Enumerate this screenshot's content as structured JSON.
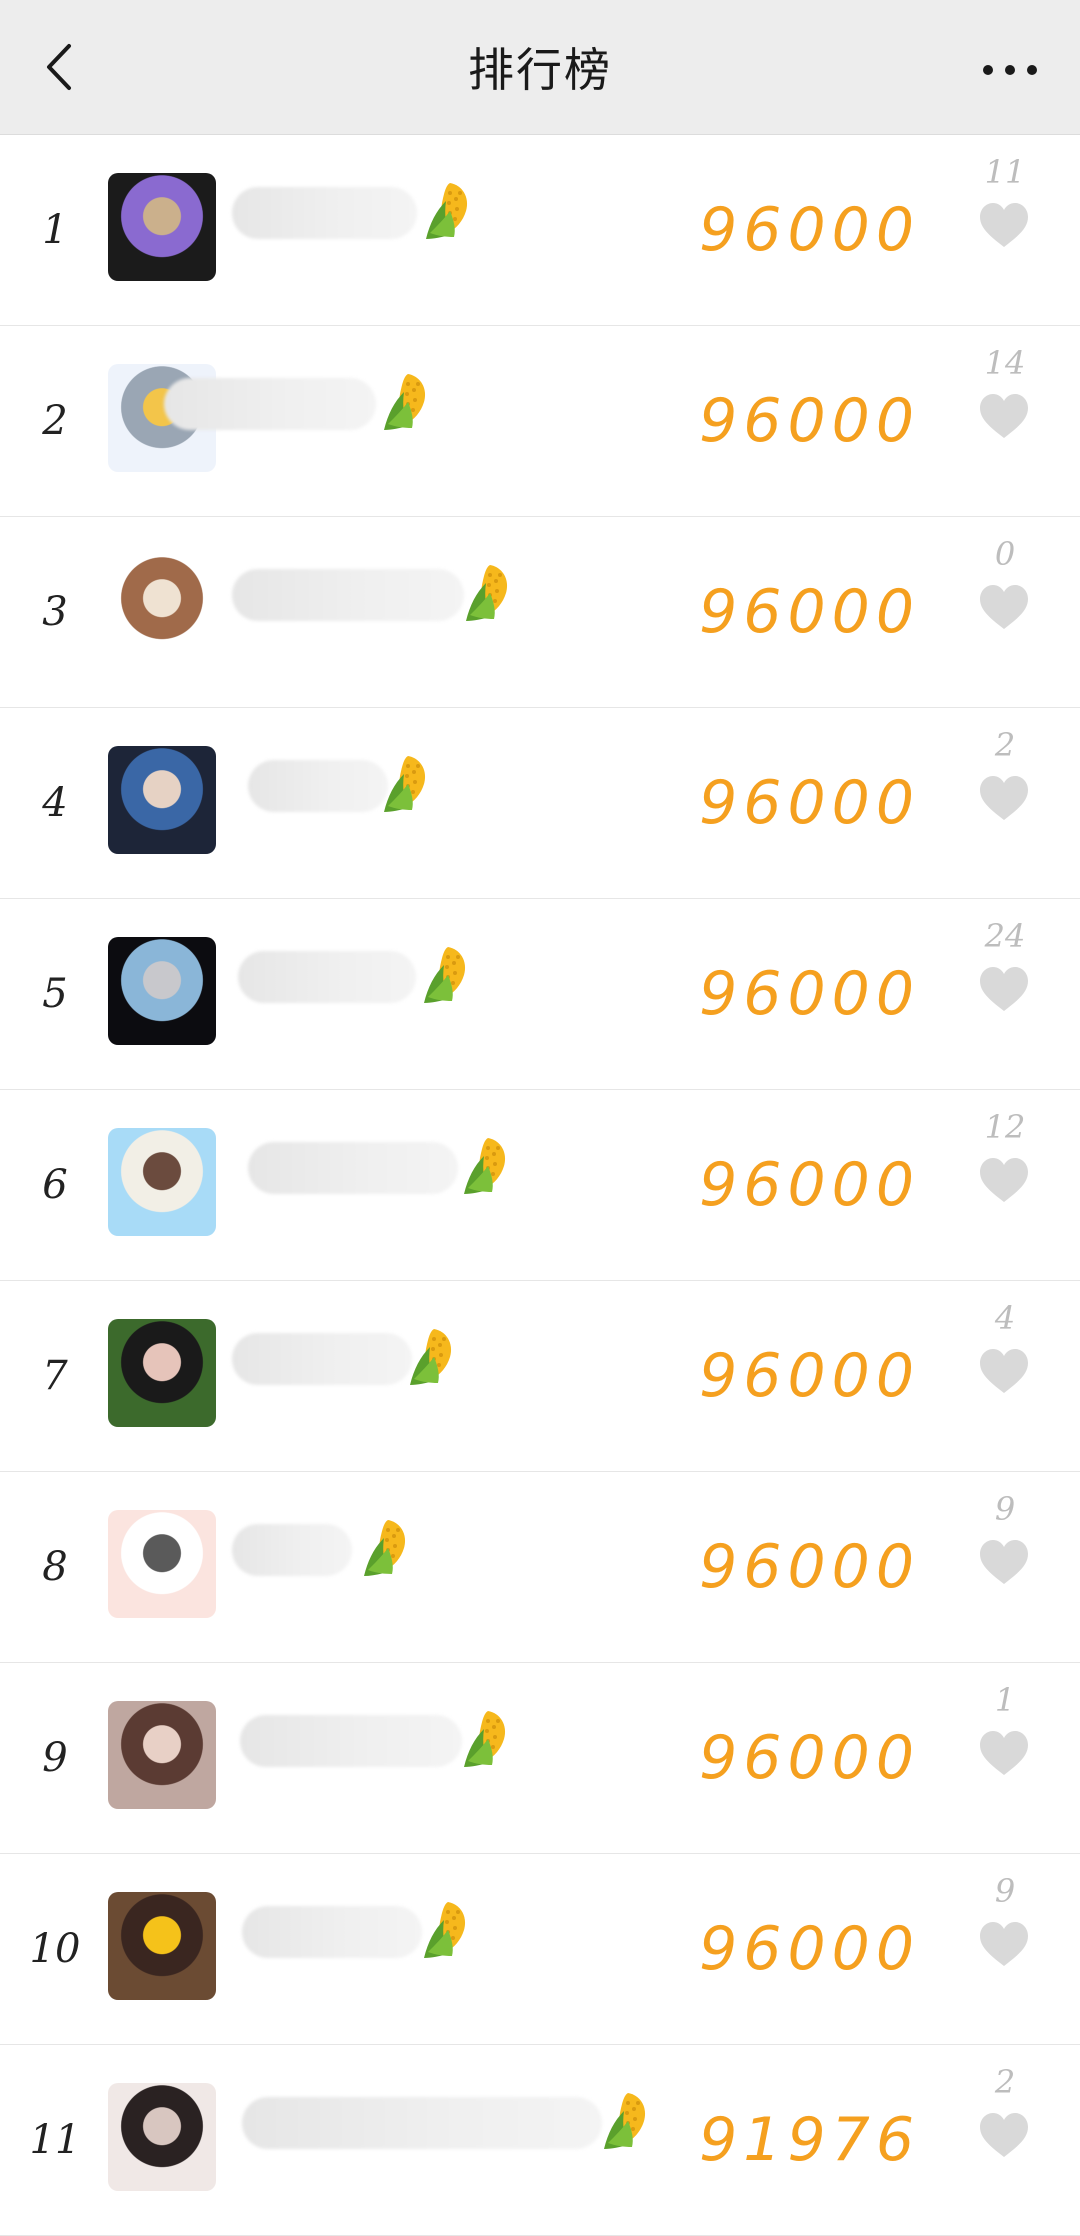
{
  "header": {
    "title": "排行榜",
    "back_icon": "chevron-left-icon",
    "more_icon": "more-horizontal-icon"
  },
  "colors": {
    "header_bg": "#ededed",
    "score": "#f5a01f",
    "likes": "#bdbdbd",
    "heart": "#d9d9d9"
  },
  "rows": [
    {
      "rank": "1",
      "score": "96000",
      "likes": "11",
      "avatar_colors": [
        "#1b1b1b",
        "#8a6ad0",
        "#cbb08c"
      ]
    },
    {
      "rank": "2",
      "score": "96000",
      "likes": "14",
      "avatar_colors": [
        "#eef3fb",
        "#9aa6b4",
        "#f3c54a"
      ]
    },
    {
      "rank": "3",
      "score": "96000",
      "likes": "0",
      "avatar_colors": [
        "#ffffff",
        "#a06a4a",
        "#efe2d2"
      ]
    },
    {
      "rank": "4",
      "score": "96000",
      "likes": "2",
      "avatar_colors": [
        "#1d2538",
        "#3a67a6",
        "#e6d2c4"
      ]
    },
    {
      "rank": "5",
      "score": "96000",
      "likes": "24",
      "avatar_colors": [
        "#0c0c10",
        "#8ab6d8",
        "#c8c8cc"
      ]
    },
    {
      "rank": "6",
      "score": "96000",
      "likes": "12",
      "avatar_colors": [
        "#a8dbf7",
        "#f2efe6",
        "#6b4b3e"
      ]
    },
    {
      "rank": "7",
      "score": "96000",
      "likes": "4",
      "avatar_colors": [
        "#3c6a2c",
        "#1a1a1a",
        "#e6c4ba"
      ]
    },
    {
      "rank": "8",
      "score": "96000",
      "likes": "9",
      "avatar_colors": [
        "#fbe4df",
        "#ffffff",
        "#5a5a5a"
      ]
    },
    {
      "rank": "9",
      "score": "96000",
      "likes": "1",
      "avatar_colors": [
        "#bfa7a0",
        "#5b3b33",
        "#e8d0c6"
      ]
    },
    {
      "rank": "10",
      "score": "96000",
      "likes": "9",
      "avatar_colors": [
        "#6b4b33",
        "#3a2620",
        "#f5c21a"
      ]
    },
    {
      "rank": "11",
      "score": "91976",
      "likes": "2",
      "avatar_colors": [
        "#f0e8e6",
        "#2a2222",
        "#d8c6c0"
      ]
    }
  ]
}
